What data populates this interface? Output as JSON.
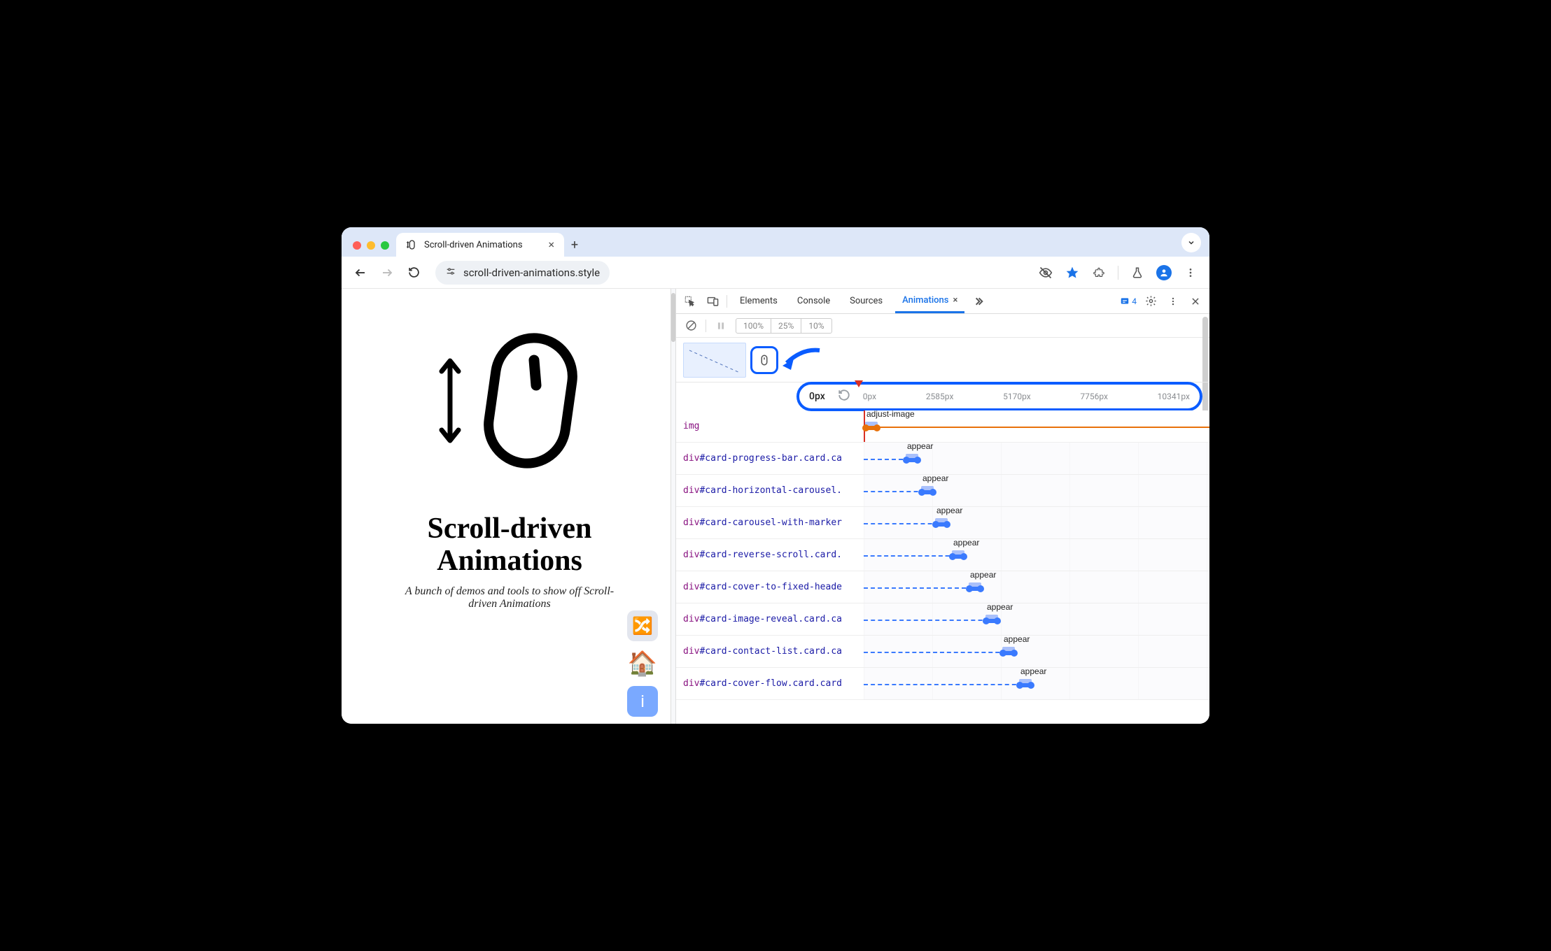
{
  "browser": {
    "tab_title": "Scroll-driven Animations",
    "url": "scroll-driven-animations.style"
  },
  "page": {
    "title_line1": "Scroll-driven",
    "title_line2": "Animations",
    "subtitle": "A bunch of demos and tools to show off Scroll-driven Animations",
    "emoji_house": "🏠",
    "emoji_shuffle": "🔀",
    "emoji_info": "ℹ️"
  },
  "devtools": {
    "tabs": [
      "Elements",
      "Console",
      "Sources",
      "Animations"
    ],
    "active_tab": "Animations",
    "message_count": "4",
    "speeds": [
      "100%",
      "25%",
      "10%"
    ],
    "ruler": {
      "current": "0px",
      "marks": [
        "0px",
        "2585px",
        "5170px",
        "7756px",
        "10341px"
      ]
    },
    "rows": [
      {
        "tag": "img",
        "id": "",
        "cls": "",
        "anim": "adjust-image",
        "offset": 0,
        "first": true
      },
      {
        "tag": "div",
        "id": "#card-progress-bar",
        "cls": ".card.ca",
        "anim": "appear",
        "offset": 58
      },
      {
        "tag": "div",
        "id": "#card-horizontal-carousel",
        "cls": ".",
        "anim": "appear",
        "offset": 80
      },
      {
        "tag": "div",
        "id": "#card-carousel-with-marker",
        "cls": "",
        "anim": "appear",
        "offset": 100
      },
      {
        "tag": "div",
        "id": "#card-reverse-scroll",
        "cls": ".card.",
        "anim": "appear",
        "offset": 124
      },
      {
        "tag": "div",
        "id": "#card-cover-to-fixed-heade",
        "cls": "",
        "anim": "appear",
        "offset": 148
      },
      {
        "tag": "div",
        "id": "#card-image-reveal",
        "cls": ".card.ca",
        "anim": "appear",
        "offset": 172
      },
      {
        "tag": "div",
        "id": "#card-contact-list",
        "cls": ".card.ca",
        "anim": "appear",
        "offset": 196
      },
      {
        "tag": "div",
        "id": "#card-cover-flow",
        "cls": ".card.card",
        "anim": "appear",
        "offset": 220
      }
    ]
  }
}
